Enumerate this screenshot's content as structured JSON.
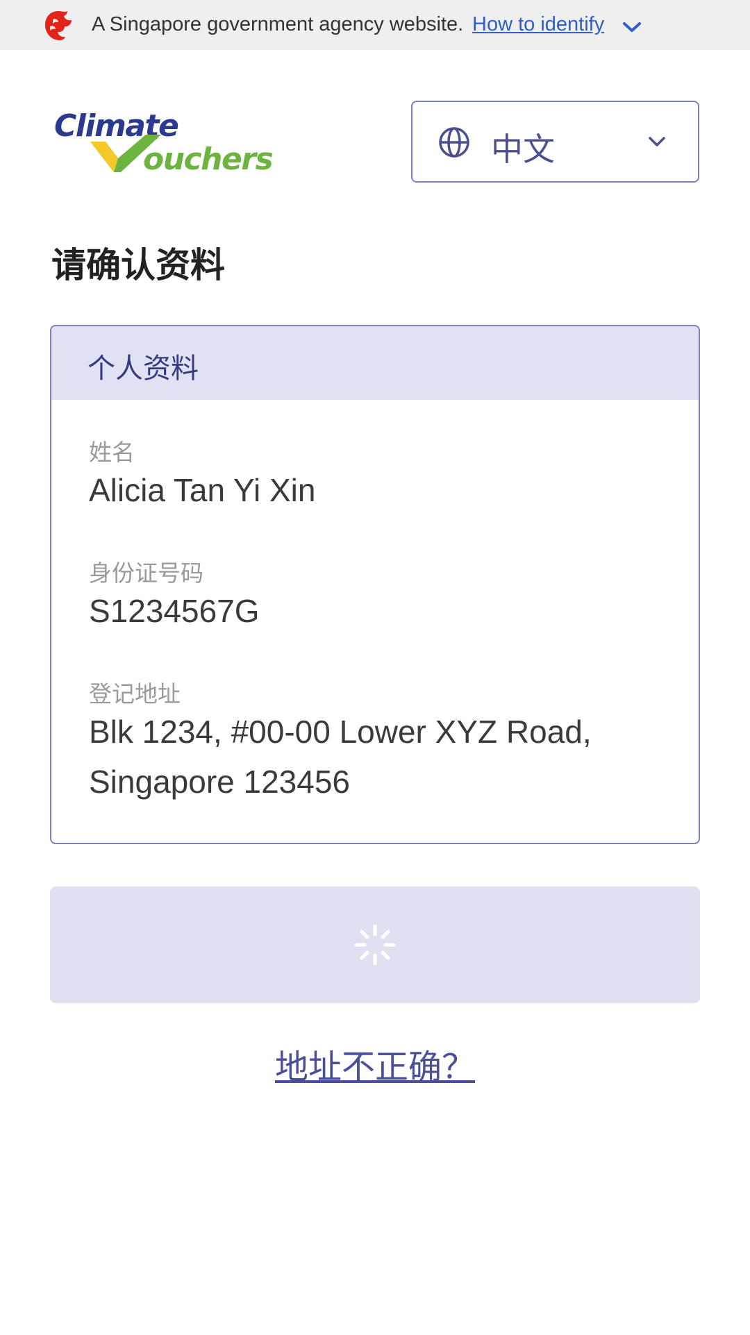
{
  "masthead": {
    "text": "A Singapore government agency website.",
    "link": "How to identify",
    "lion_icon": "merlion-crest-icon",
    "chevron_icon": "chevron-down-icon"
  },
  "logo": {
    "line1": "Climate",
    "line2": "ouchers",
    "colors": {
      "blue": "#2b3a8f",
      "green": "#6cb33f"
    }
  },
  "language": {
    "selected": "中文",
    "icon": "globe-icon",
    "chevron_icon": "chevron-down-icon"
  },
  "page": {
    "title": "请确认资料"
  },
  "card": {
    "title": "个人资料",
    "fields": [
      {
        "label": "姓名",
        "value": "Alicia Tan Yi Xin"
      },
      {
        "label": "身份证号码",
        "value": "S1234567G"
      },
      {
        "label": "登记地址",
        "value_line1": "Blk 1234, #00-00 Lower XYZ Road,",
        "value_line2": "Singapore 123456"
      }
    ]
  },
  "submit": {
    "state": "loading",
    "icon": "loading-spinner-icon"
  },
  "address_link": "地址不正确？",
  "colors": {
    "accent": "#4a4f9a",
    "card_border": "#7b80bd",
    "card_header_bg": "#e0e1f3",
    "masthead_link": "#2e5fc9",
    "masthead_bg": "#efefef"
  }
}
